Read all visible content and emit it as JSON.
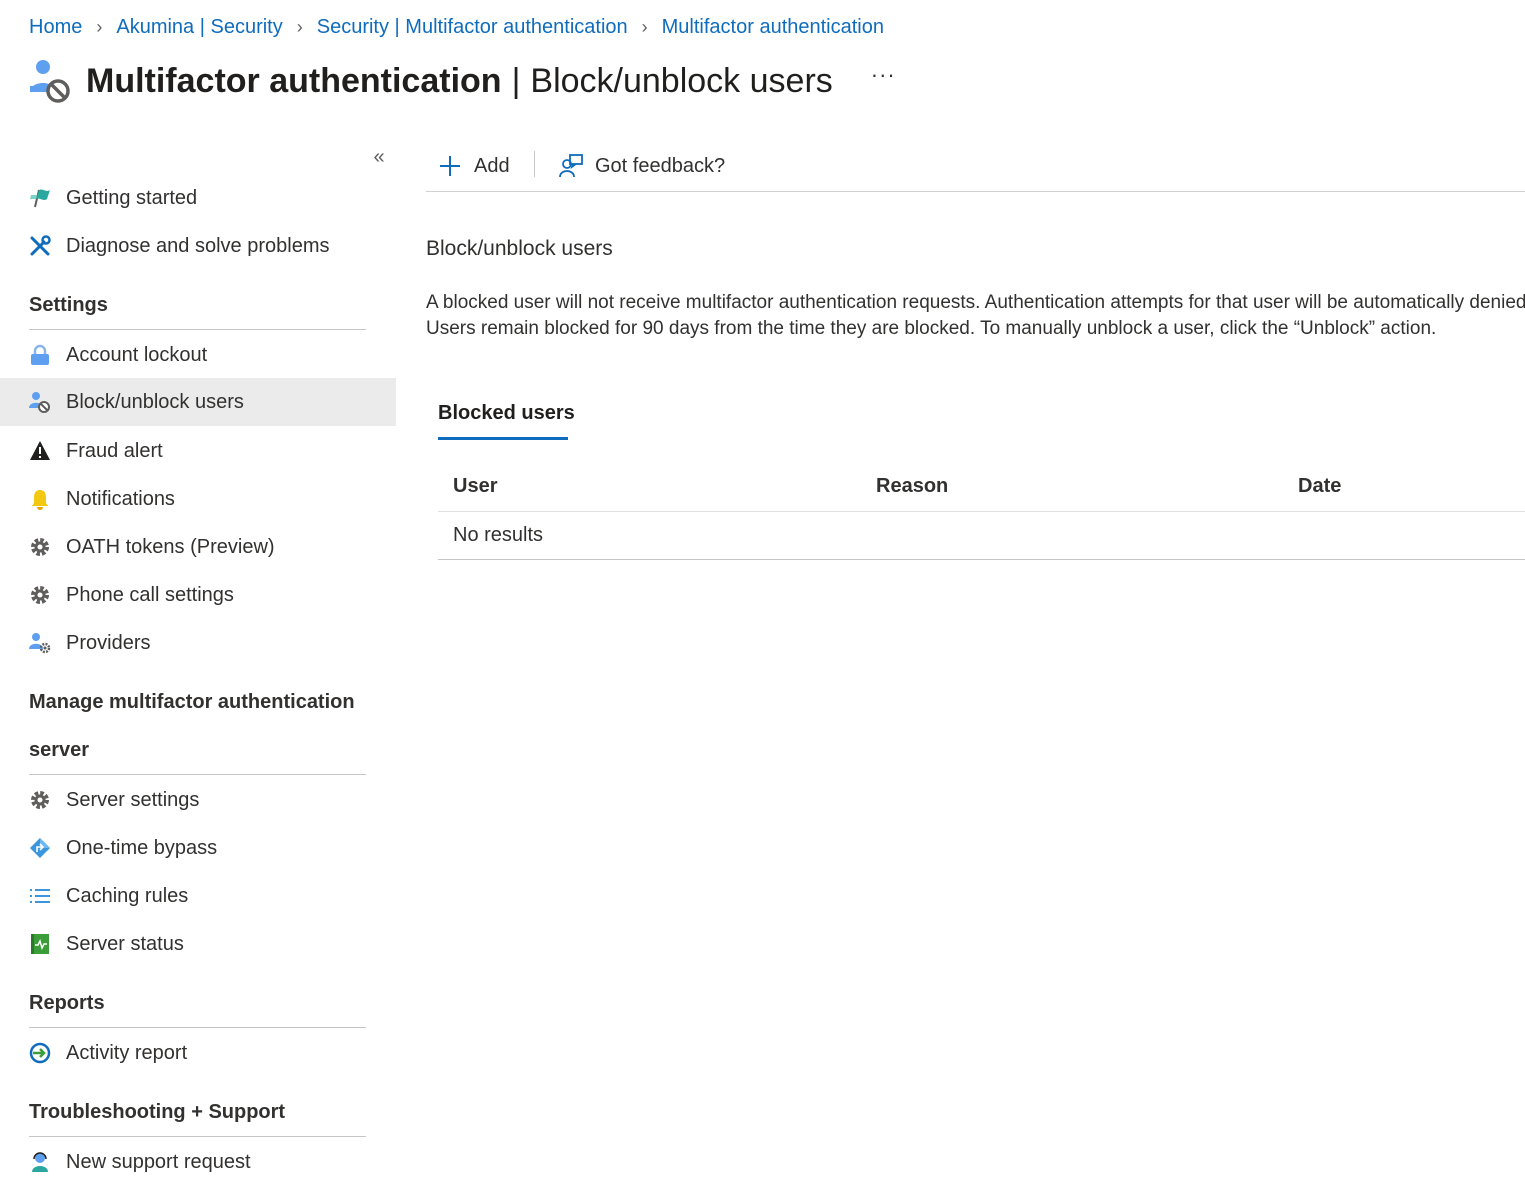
{
  "breadcrumb": [
    "Home",
    "Akumina | Security",
    "Security | Multifactor authentication",
    "Multifactor authentication"
  ],
  "header": {
    "title_main": "Multifactor authentication",
    "title_sep": "|",
    "title_sub": "Block/unblock users",
    "more": "···"
  },
  "sidebar": {
    "collapse": "«",
    "top_items": [
      {
        "label": "Getting started",
        "icon": "flag-icon"
      },
      {
        "label": "Diagnose and solve problems",
        "icon": "wrench-icon"
      }
    ],
    "sections": [
      {
        "title": "Settings",
        "items": [
          {
            "label": "Account lockout",
            "icon": "lock-icon"
          },
          {
            "label": "Block/unblock users",
            "icon": "user-block-icon",
            "active": true
          },
          {
            "label": "Fraud alert",
            "icon": "warning-icon"
          },
          {
            "label": "Notifications",
            "icon": "bell-icon"
          },
          {
            "label": "OATH tokens (Preview)",
            "icon": "gear-icon"
          },
          {
            "label": "Phone call settings",
            "icon": "gear-icon"
          },
          {
            "label": "Providers",
            "icon": "user-gear-icon"
          }
        ]
      },
      {
        "title_line1": "Manage multifactor authentication",
        "title_line2": "server",
        "items": [
          {
            "label": "Server settings",
            "icon": "gear-icon"
          },
          {
            "label": "One-time bypass",
            "icon": "diamond-arrow-icon"
          },
          {
            "label": "Caching rules",
            "icon": "list-icon"
          },
          {
            "label": "Server status",
            "icon": "book-pulse-icon"
          }
        ]
      },
      {
        "title": "Reports",
        "items": [
          {
            "label": "Activity report",
            "icon": "circle-arrow-icon"
          }
        ]
      },
      {
        "title": "Troubleshooting + Support",
        "items": [
          {
            "label": "New support request",
            "icon": "support-person-icon"
          }
        ]
      }
    ]
  },
  "toolbar": {
    "add_label": "Add",
    "feedback_label": "Got feedback?"
  },
  "content": {
    "title": "Block/unblock users",
    "description": "A blocked user will not receive multifactor authentication requests. Authentication attempts for that user will be automatically denied. Users remain blocked for 90 days from the time they are blocked. To manually unblock a user, click the “Unblock” action.",
    "tab_label": "Blocked users",
    "table": {
      "columns": [
        "User",
        "Reason",
        "Date"
      ],
      "empty_text": "No results"
    }
  },
  "colors": {
    "link": "#0f6cbd",
    "active_bg": "#ebebeb",
    "text": "#323130"
  }
}
